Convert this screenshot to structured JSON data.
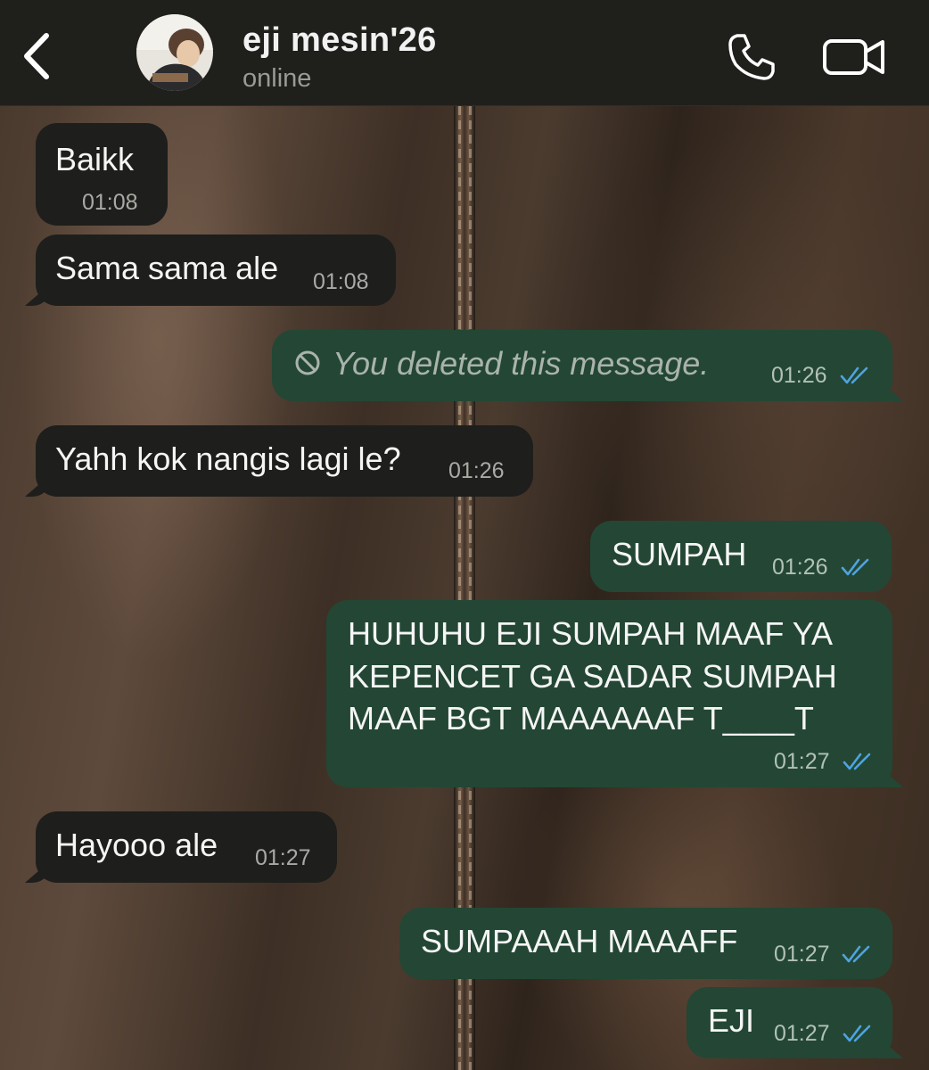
{
  "header": {
    "contact_name": "eji mesin'26",
    "status": "online",
    "icons": {
      "back": "chevron-left-icon",
      "call": "phone-icon",
      "video": "video-camera-icon"
    }
  },
  "messages": [
    {
      "direction": "incoming",
      "text": "Baikk",
      "time": "01:08"
    },
    {
      "direction": "incoming",
      "text": "Sama sama ale",
      "time": "01:08"
    },
    {
      "direction": "outgoing",
      "text": "You deleted this message.",
      "time": "01:26",
      "deleted": true,
      "read": true
    },
    {
      "direction": "incoming",
      "text": "Yahh kok nangis lagi le?",
      "time": "01:26"
    },
    {
      "direction": "outgoing",
      "text": "SUMPAH",
      "time": "01:26",
      "read": true
    },
    {
      "direction": "outgoing",
      "lines": [
        "HUHUHU EJI SUMPAH MAAF YA",
        "KEPENCET GA SADAR SUMPAH",
        "MAAF BGT MAAAAAAF T____T"
      ],
      "time": "01:27",
      "read": true
    },
    {
      "direction": "incoming",
      "text": "Hayooo ale",
      "time": "01:27"
    },
    {
      "direction": "outgoing",
      "text": "SUMPAAAH MAAAFF",
      "time": "01:27",
      "read": true
    },
    {
      "direction": "outgoing",
      "text": "EJI",
      "time": "01:27",
      "read": true
    }
  ],
  "colors": {
    "header_bg": "#1f1f1c",
    "incoming_bubble": "#1e1e1c",
    "outgoing_bubble": "#234734",
    "read_tick": "#4fa3e0"
  }
}
